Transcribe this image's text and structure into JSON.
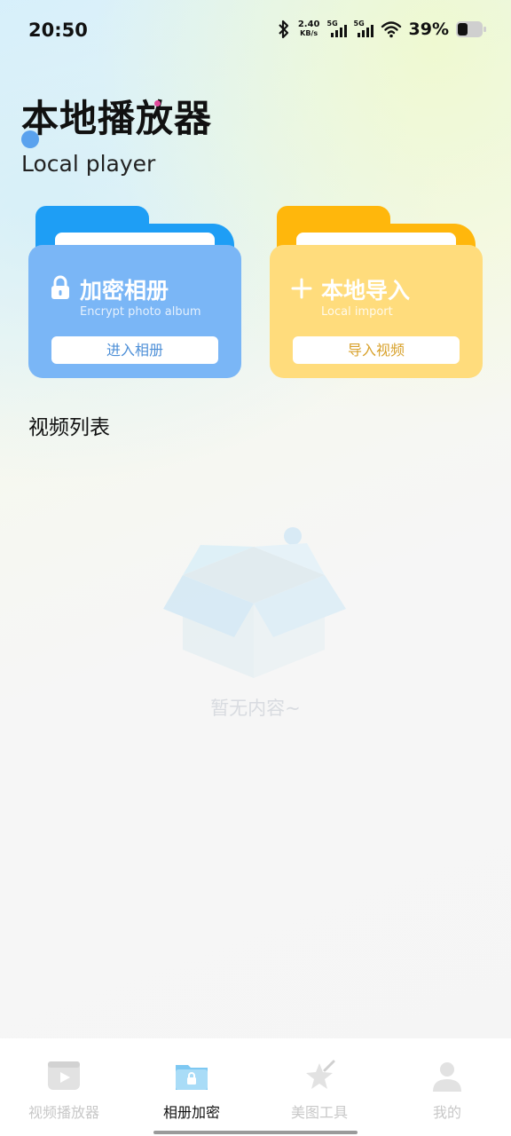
{
  "status_bar": {
    "time": "20:50",
    "net_speed_value": "2.40",
    "net_speed_unit": "KB/s",
    "sim1_label": "5G",
    "sim2_label": "5G",
    "battery": "39%",
    "icons": [
      "bluetooth-icon",
      "signal-icon",
      "wifi-icon",
      "battery-icon"
    ]
  },
  "header": {
    "title": "本地播放器",
    "subtitle": "Local player"
  },
  "cards": [
    {
      "title": "加密相册",
      "subtitle": "Encrypt photo album",
      "button": "进入相册",
      "icon": "lock-icon",
      "colors": {
        "tab": "#1e9ef5",
        "front": "#7ab6f6"
      }
    },
    {
      "title": "本地导入",
      "subtitle": "Local import",
      "button": "导入视频",
      "icon": "plus-icon",
      "colors": {
        "tab": "#ffb70c",
        "front": "#ffdc7c"
      }
    }
  ],
  "section_title": "视频列表",
  "empty_state": {
    "text": "暂无内容~",
    "icon": "empty-box-icon"
  },
  "bottom_nav": {
    "items": [
      {
        "label": "视频播放器",
        "icon": "video-icon",
        "active": false
      },
      {
        "label": "相册加密",
        "icon": "folder-lock-icon",
        "active": true
      },
      {
        "label": "美图工具",
        "icon": "magic-star-icon",
        "active": false
      },
      {
        "label": "我的",
        "icon": "person-icon",
        "active": false
      }
    ]
  }
}
